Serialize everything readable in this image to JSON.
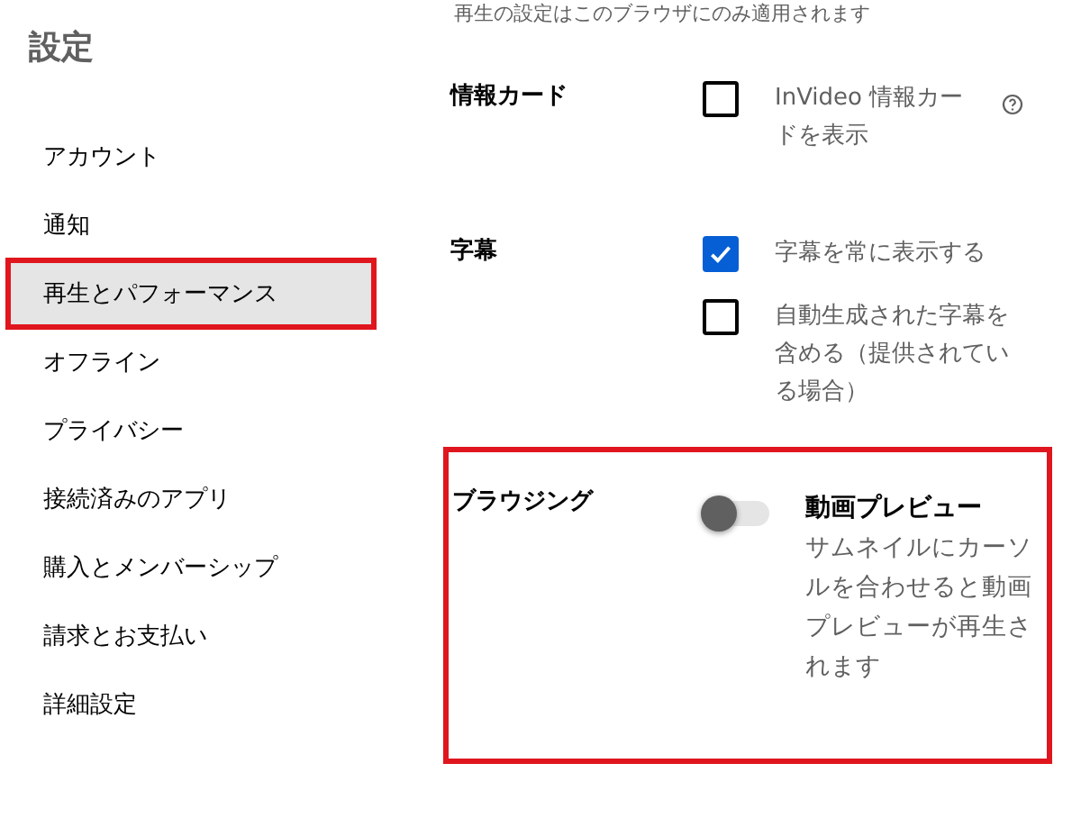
{
  "sidebar": {
    "title": "設定",
    "items": [
      {
        "label": "アカウント",
        "selected": false,
        "highlighted": false
      },
      {
        "label": "通知",
        "selected": false,
        "highlighted": false
      },
      {
        "label": "再生とパフォーマンス",
        "selected": true,
        "highlighted": true
      },
      {
        "label": "オフライン",
        "selected": false,
        "highlighted": false
      },
      {
        "label": "プライバシー",
        "selected": false,
        "highlighted": false
      },
      {
        "label": "接続済みのアプリ",
        "selected": false,
        "highlighted": false
      },
      {
        "label": "購入とメンバーシップ",
        "selected": false,
        "highlighted": false
      },
      {
        "label": "請求とお支払い",
        "selected": false,
        "highlighted": false
      },
      {
        "label": "詳細設定",
        "selected": false,
        "highlighted": false
      }
    ]
  },
  "content": {
    "note": "再生の設定はこのブラウザにのみ適用されます",
    "sections": [
      {
        "label": "情報カード",
        "highlighted": false,
        "options": [
          {
            "kind": "checkbox",
            "label": "InVideo 情報カードを表示",
            "checked": false,
            "help": true
          }
        ]
      },
      {
        "label": "字幕",
        "highlighted": false,
        "options": [
          {
            "kind": "checkbox",
            "label": "字幕を常に表示する",
            "checked": true,
            "help": false
          },
          {
            "kind": "checkbox",
            "label": "自動生成された字幕を含める（提供されている場合）",
            "checked": false,
            "help": false
          }
        ]
      },
      {
        "label": "ブラウジング",
        "highlighted": true,
        "options": [
          {
            "kind": "toggle",
            "label": "動画プレビュー",
            "description": "サムネイルにカーソルを合わせると動画プレビューが再生されます",
            "on": false,
            "help": false
          }
        ]
      }
    ]
  }
}
